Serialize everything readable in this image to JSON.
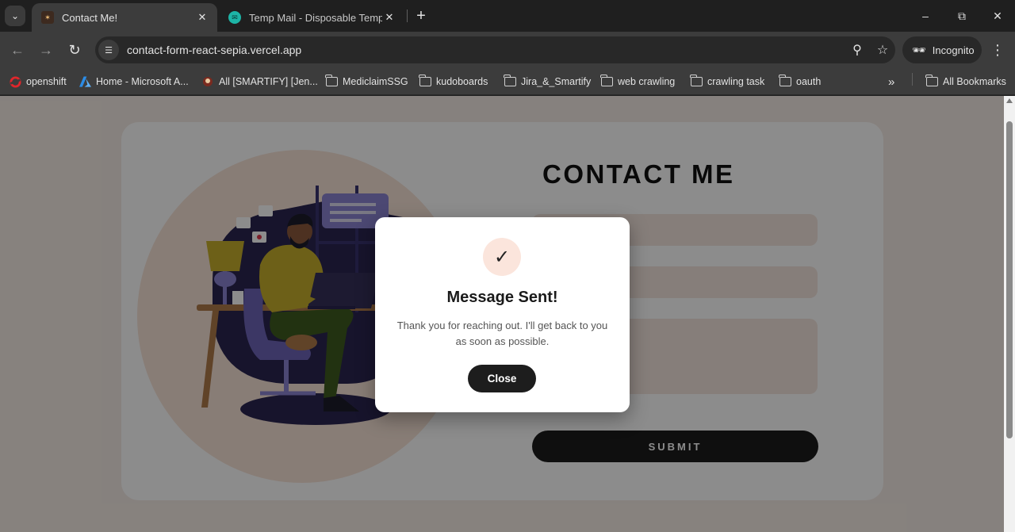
{
  "browser": {
    "tabs": [
      {
        "title": "Contact Me!",
        "active": true,
        "favicon": "contact-favicon"
      },
      {
        "title": "Temp Mail - Disposable Tempor",
        "active": false,
        "favicon": "tempmail-favicon"
      }
    ],
    "url": "contact-form-react-sepia.vercel.app",
    "profile_label": "Incognito",
    "bookmarks": [
      {
        "label": "openshift",
        "icon": "openshift-icon"
      },
      {
        "label": "Home - Microsoft A...",
        "icon": "azure-icon"
      },
      {
        "label": "All [SMARTIFY] [Jen...",
        "icon": "jenkins-icon"
      },
      {
        "label": "MediclaimSSG",
        "icon": "folder-icon"
      },
      {
        "label": "kudoboards",
        "icon": "folder-icon"
      },
      {
        "label": "Jira_&_Smartify",
        "icon": "folder-icon"
      },
      {
        "label": "web crawling",
        "icon": "folder-icon"
      },
      {
        "label": "crawling task",
        "icon": "folder-icon"
      },
      {
        "label": "oauth",
        "icon": "folder-icon"
      }
    ],
    "overflow_label": "»",
    "all_bookmarks_label": "All Bookmarks"
  },
  "page": {
    "heading": "CONTACT ME",
    "submit_label": "SUBMIT"
  },
  "modal": {
    "icon": "✓",
    "title": "Message Sent!",
    "message": "Thank you for reaching out. I'll get back to you as soon as possible.",
    "close_label": "Close"
  },
  "colors": {
    "accent_dark": "#1d1d1d",
    "soft_peach": "#f7e3d8",
    "field_bg": "#f5e6de",
    "illustration_navy": "#2a2550",
    "illustration_yellow": "#c7b02c",
    "illustration_purple": "#8b84d1"
  }
}
